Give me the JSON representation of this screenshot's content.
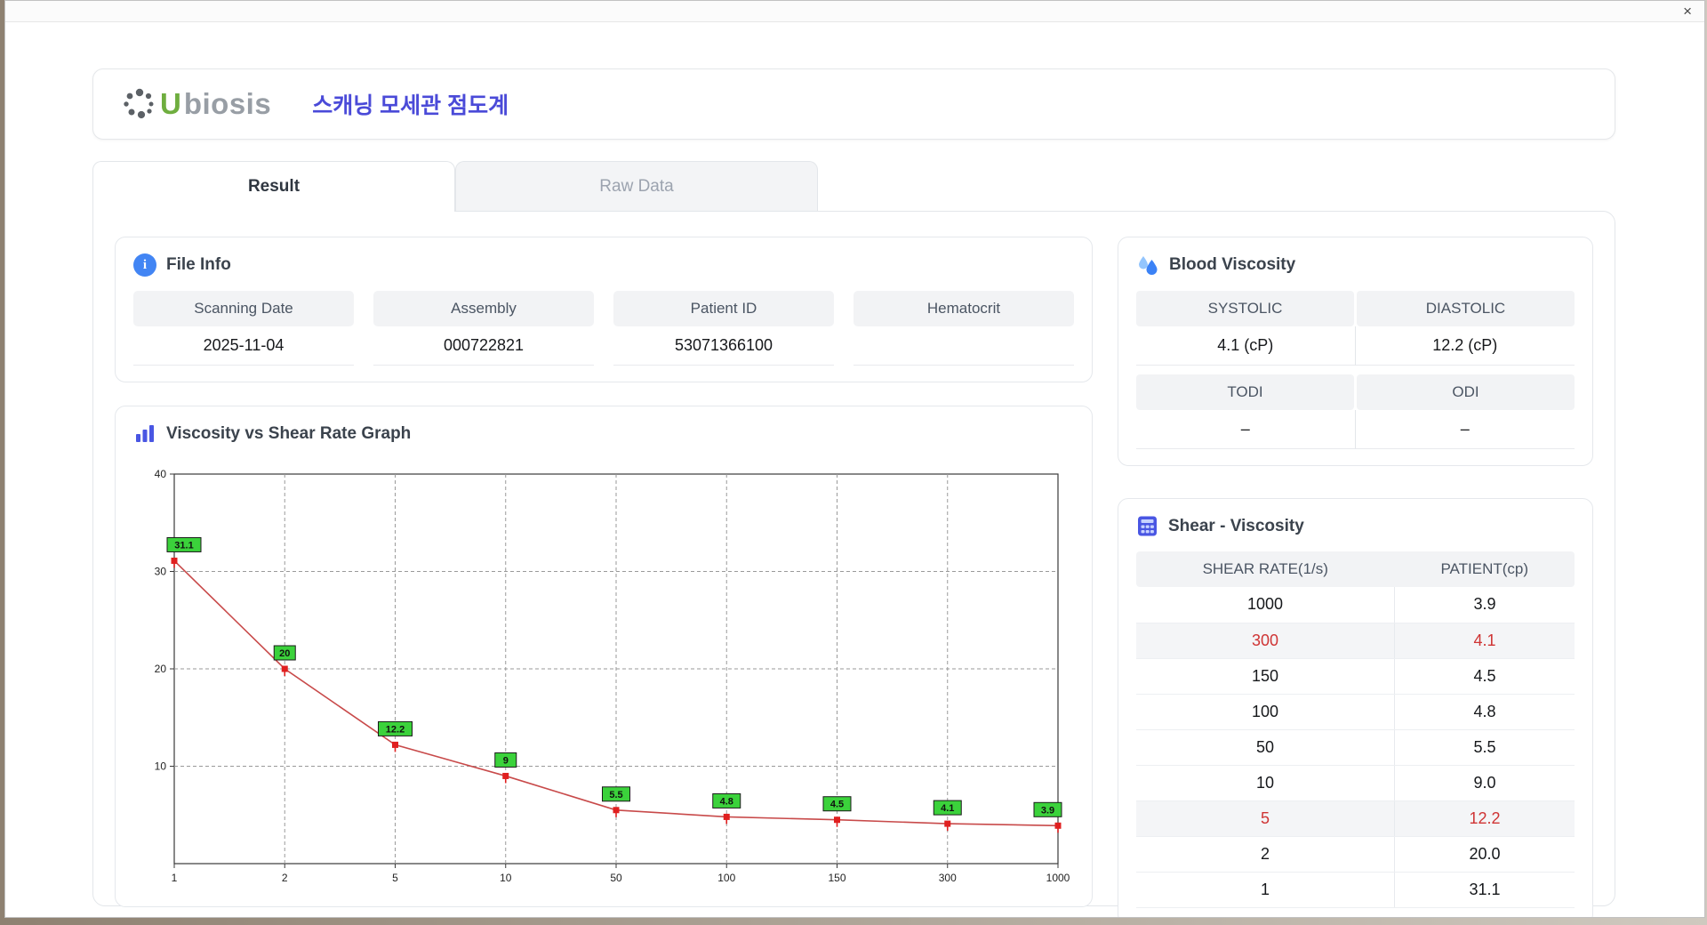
{
  "window": {
    "close_label": "×"
  },
  "header": {
    "logo_u": "U",
    "logo_rest": "biosis",
    "title": "스캐닝 모세관 점도계"
  },
  "tabs": [
    {
      "label": "Result"
    },
    {
      "label": "Raw Data"
    }
  ],
  "file_info": {
    "title": "File Info",
    "fields": [
      {
        "label": "Scanning Date",
        "value": "2025-11-04"
      },
      {
        "label": "Assembly",
        "value": "000722821"
      },
      {
        "label": "Patient ID",
        "value": "53071366100"
      },
      {
        "label": "Hematocrit",
        "value": ""
      }
    ]
  },
  "blood_viscosity": {
    "title": "Blood Viscosity",
    "cells": [
      {
        "label": "SYSTOLIC",
        "value": "4.1 (cP)"
      },
      {
        "label": "DIASTOLIC",
        "value": "12.2 (cP)"
      },
      {
        "label": "TODI",
        "value": "–"
      },
      {
        "label": "ODI",
        "value": "–"
      }
    ]
  },
  "shear_table": {
    "title": "Shear - Viscosity",
    "columns": [
      "SHEAR RATE(1/s)",
      "PATIENT(cp)"
    ],
    "rows": [
      {
        "shear": "1000",
        "patient": "3.9",
        "highlight": false
      },
      {
        "shear": "300",
        "patient": "4.1",
        "highlight": true
      },
      {
        "shear": "150",
        "patient": "4.5",
        "highlight": false
      },
      {
        "shear": "100",
        "patient": "4.8",
        "highlight": false
      },
      {
        "shear": "50",
        "patient": "5.5",
        "highlight": false
      },
      {
        "shear": "10",
        "patient": "9.0",
        "highlight": false
      },
      {
        "shear": "5",
        "patient": "12.2",
        "highlight": true
      },
      {
        "shear": "2",
        "patient": "20.0",
        "highlight": false
      },
      {
        "shear": "1",
        "patient": "31.1",
        "highlight": false
      }
    ]
  },
  "chart_data": {
    "type": "line",
    "title": "Viscosity vs Shear Rate Graph",
    "x_categories": [
      "1",
      "2",
      "5",
      "10",
      "50",
      "100",
      "150",
      "300",
      "1000"
    ],
    "series": [
      {
        "name": "Patient viscosity (cP)",
        "values": [
          31.1,
          20,
          12.2,
          9,
          5.5,
          4.8,
          4.5,
          4.1,
          3.9
        ]
      }
    ],
    "point_labels": [
      "31.1",
      "20",
      "12.2",
      "9",
      "5.5",
      "4.8",
      "4.5",
      "4.1",
      "3.9"
    ],
    "xlabel": "",
    "ylabel": "",
    "ylim": [
      0,
      40
    ],
    "yticks": [
      10,
      20,
      30,
      40
    ],
    "x_axis_type": "categorical",
    "grid": "dashed",
    "legend": "none",
    "line_color": "#c84a4a",
    "marker_color": "#e01f1f",
    "label_bg": "#3bd23b",
    "label_border": "#1a1a1a"
  }
}
